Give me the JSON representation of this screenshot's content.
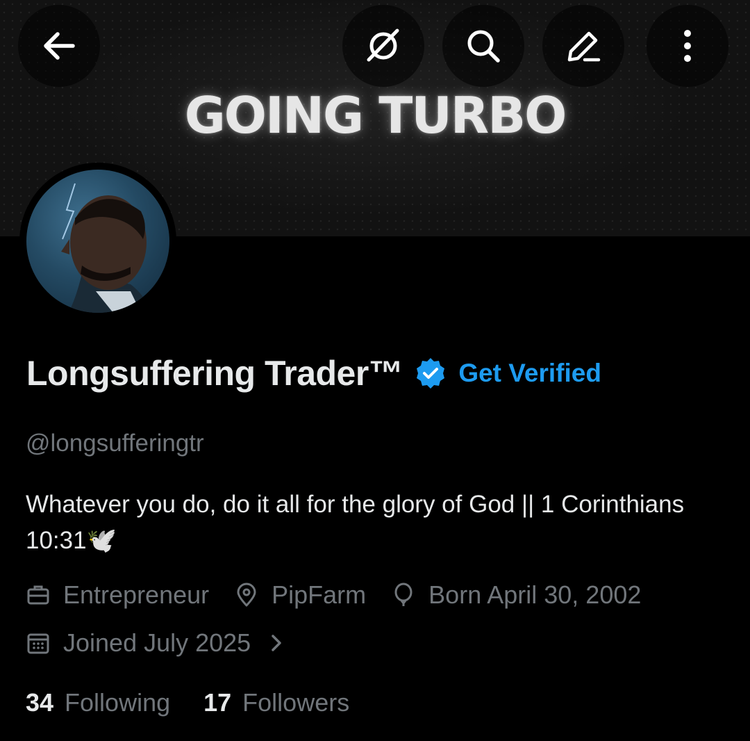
{
  "header": {
    "banner_title": "GOING TURBO",
    "buttons": [
      {
        "name": "back-button",
        "icon": "arrow-left-icon"
      },
      {
        "name": "grok-button",
        "icon": "grok-icon"
      },
      {
        "name": "search-button",
        "icon": "search-icon"
      },
      {
        "name": "edit-button",
        "icon": "pencil-icon"
      },
      {
        "name": "more-button",
        "icon": "more-vertical-icon"
      }
    ]
  },
  "profile": {
    "display_name": "Longsuffering Trader™",
    "verified_badge_icon": "verified-badge-icon",
    "get_verified_label": "Get Verified",
    "handle": "@longsufferingtr",
    "bio": "Whatever you do, do it all for the glory of God || 1 Corinthians 10:31🕊️",
    "meta": {
      "profession": "Entrepreneur",
      "location": "PipFarm",
      "birthday": "Born April 30, 2002",
      "joined": "Joined July 2025"
    },
    "stats": {
      "following_count": "34",
      "following_label": "Following",
      "followers_count": "17",
      "followers_label": "Followers"
    }
  },
  "colors": {
    "accent": "#1d9bf0",
    "muted_text": "#71767b",
    "primary_text": "#e7e9ea",
    "background": "#000000"
  }
}
